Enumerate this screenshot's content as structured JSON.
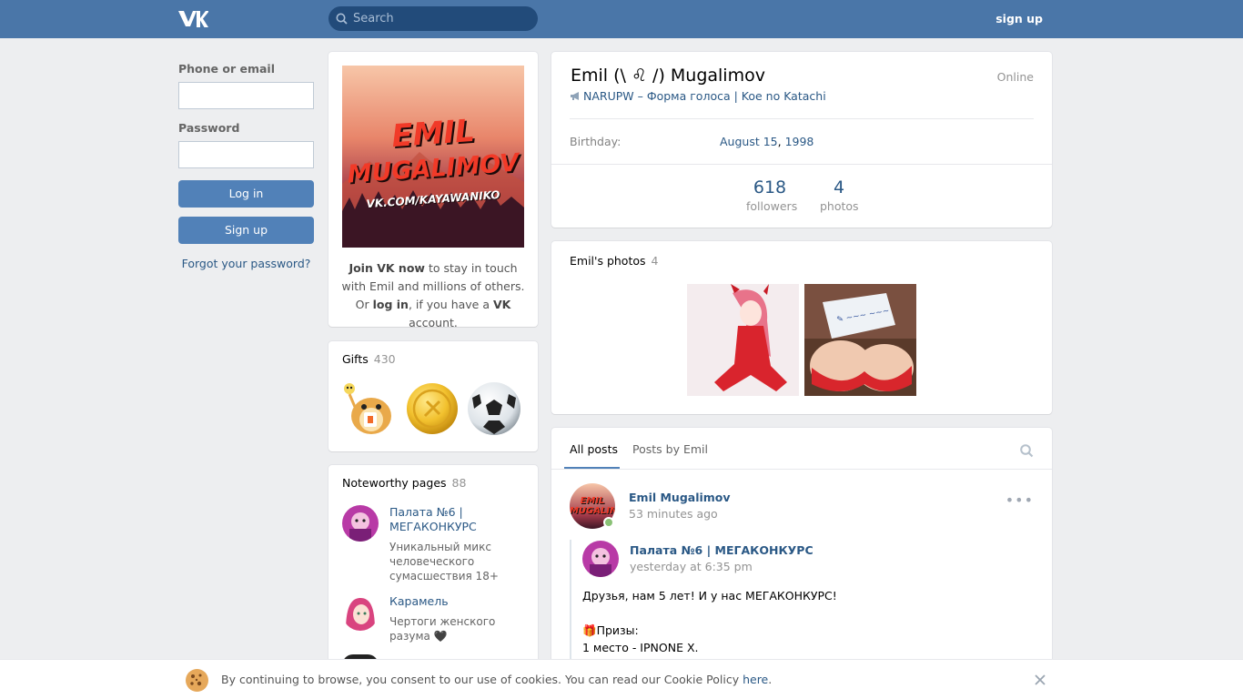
{
  "header": {
    "search_placeholder": "Search",
    "signup_label": "sign up"
  },
  "login": {
    "phone_label": "Phone or email",
    "password_label": "Password",
    "login_button": "Log in",
    "signup_button": "Sign up",
    "forgot_link": "Forgot your password?"
  },
  "avatar": {
    "line1": "EMIL",
    "line2": "MUGALIMOV",
    "line3": "VK.COM/KAYAWANIKO"
  },
  "join": {
    "part1": "Join VK now",
    "part2": " to stay in touch with Emil and millions of others.",
    "part3": "Or ",
    "part4": "log in",
    "part5": ", if you have a ",
    "part6": "VK",
    "part7": " account."
  },
  "gifts": {
    "title": "Gifts",
    "count": "430"
  },
  "noteworthy": {
    "title": "Noteworthy pages",
    "count": "88",
    "items": [
      {
        "name": "Палата №6 | МЕГАКОНКУРС",
        "desc": "Уникальный микс человеческого сумасшествия 18+"
      },
      {
        "name": "Карамель",
        "desc": "Чертоги женского разума 🖤"
      }
    ]
  },
  "profile": {
    "name": "Emil (\\ ♌ /) Mugalimov",
    "online": "Online",
    "status": "NARUPW – Форма голоса | Koe no Katachi",
    "birthday_label": "Birthday:",
    "birthday_date": "August 15",
    "birthday_sep": ", ",
    "birthday_year": "1998",
    "followers_num": "618",
    "followers_label": "followers",
    "photos_num": "4",
    "photos_label": "photos"
  },
  "photos": {
    "title": "Emil's photos",
    "count": "4"
  },
  "wall": {
    "tab_all": "All posts",
    "tab_by": "Posts by Emil",
    "post": {
      "author": "Emil Mugalimov",
      "time": "53 minutes ago",
      "repost_author": "Палата №6 | МЕГАКОНКУРС",
      "repost_time": "yesterday at 6:35 pm",
      "line1": "Друзья, нам 5 лет! И у нас МЕГАКОНКУРС!",
      "line2": "🎁Призы:",
      "line3": "1 место - IPNONE X."
    }
  },
  "cookie": {
    "text": "By continuing to browse, you consent to our use of cookies. You can read our Cookie Policy ",
    "link": "here",
    "end": "."
  },
  "colors": {
    "header": "#4a76a8",
    "button": "#5181b8",
    "link": "#2a5885",
    "background": "#edeef0"
  }
}
